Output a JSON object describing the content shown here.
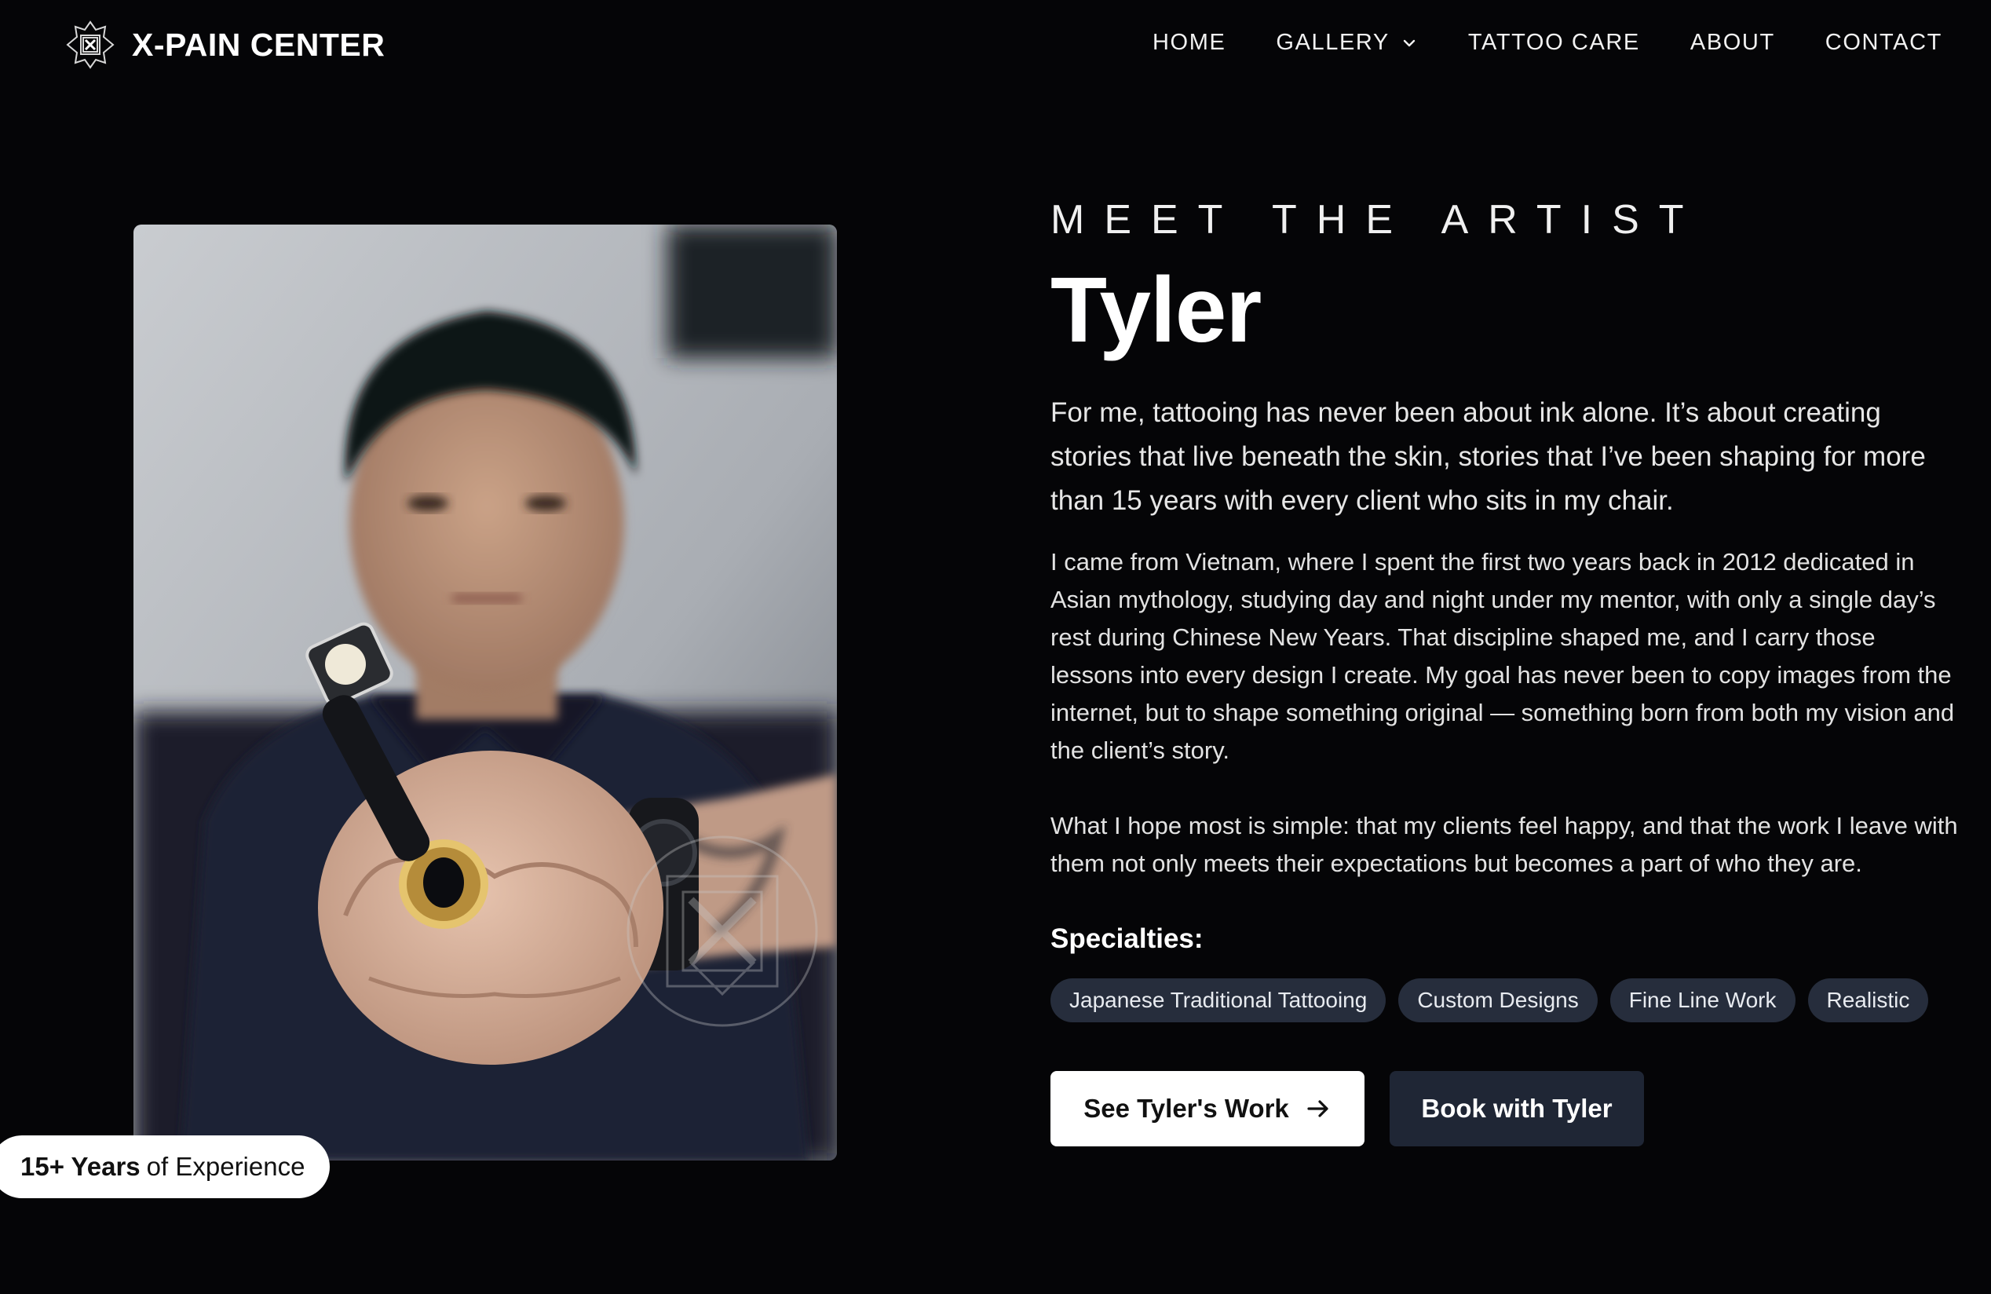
{
  "brand": {
    "name": "X-PAIN CENTER",
    "logo_icon": "x-emblem-logo-icon"
  },
  "nav": {
    "items": [
      {
        "label": "HOME"
      },
      {
        "label": "GALLERY",
        "icon": "chevron-down-icon"
      },
      {
        "label": "TATTOO CARE"
      },
      {
        "label": "ABOUT"
      },
      {
        "label": "CONTACT"
      }
    ]
  },
  "hero": {
    "photo_alt": "Portrait of Tyler holding a tattoo machine",
    "experience_badge": {
      "strong": "15+ Years",
      "rest": "of Experience"
    }
  },
  "artist": {
    "eyebrow": "MEET THE ARTIST",
    "name": "Tyler",
    "lead": "For me, tattooing has never been about ink alone. It’s about creating stories that live beneath the skin, stories that I’ve been shaping for more than 15 years with every client who sits in my chair.",
    "paragraphs": [
      "I came from Vietnam, where I spent the first two years back in 2012 dedicated in Asian mythology, studying day and night under my mentor, with only a single day’s rest during Chinese New Years. That discipline shaped me, and I carry those lessons into every design I create. My goal has never been to copy images from the internet, but to shape something original — something born from both my vision and the client’s story.",
      "What I hope most is simple: that my clients feel happy, and that the work I leave with them not only meets their expectations but becomes a part of who they are."
    ],
    "specialties_title": "Specialties:",
    "specialties": [
      "Japanese Traditional Tattooing",
      "Custom Designs",
      "Fine Line Work",
      "Realistic"
    ],
    "buttons": {
      "primary": "See Tyler's Work",
      "primary_icon": "arrow-right-icon",
      "secondary": "Book with Tyler"
    }
  },
  "colors": {
    "background": "#050507",
    "chip_background": "#262d3c",
    "secondary_button": "#1f2635",
    "primary_button": "#ffffff"
  }
}
